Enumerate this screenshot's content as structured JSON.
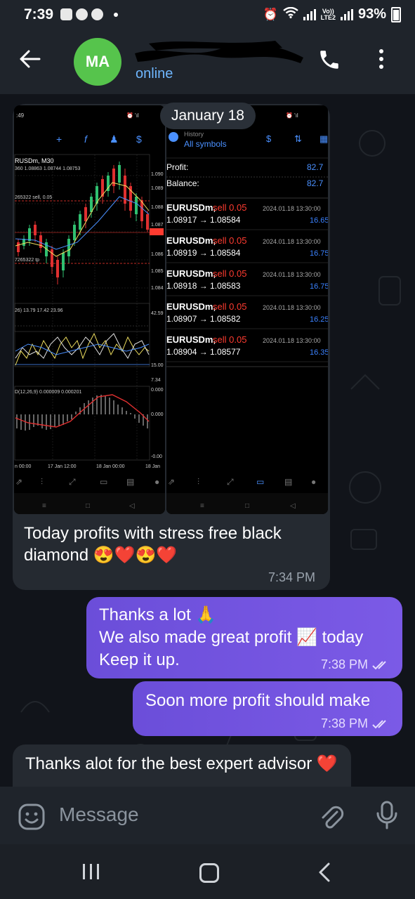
{
  "status_bar": {
    "time": "7:39",
    "battery": "93%",
    "network": "LTE2",
    "volte": "Vo))"
  },
  "header": {
    "avatar_initials": "MA",
    "status": "online",
    "back_icon": "arrow-left-icon",
    "call_icon": "phone-icon",
    "menu_icon": "more-vertical-icon"
  },
  "chat": {
    "date_pill": "January 18",
    "messages": [
      {
        "direction": "in",
        "text": "Today  profits with stress free black diamond 😍❤️😍❤️",
        "time": "7:34 PM"
      },
      {
        "direction": "out",
        "lines": [
          "Thanks a lot 🙏",
          "We also made great profit 📈 today",
          "Keep it up."
        ],
        "time": "7:38 PM"
      },
      {
        "direction": "out",
        "text": "Soon more profit should make",
        "time": "7:38 PM"
      },
      {
        "direction": "in",
        "text": "Thanks alot for the best expert advisor ❤️"
      }
    ]
  },
  "screenshot_left": {
    "symbol": "RUSDm, M30",
    "ohlc": "360 1.08863 1.08744 1.08753",
    "order_line": "265322 sell, 0.05",
    "tp_line": "7265322 tp",
    "indicator1": "26) 13.79 17.42 23.96",
    "indicator2": "D(12,26,9) 0.000009 0.000201",
    "price_labels": [
      "1.090",
      "1.089",
      "1.088",
      "1.087",
      "1.086",
      "1.085",
      "1.084"
    ],
    "ind_labels": [
      "42.59",
      "15.00",
      "7.34",
      "0.000",
      "0.000",
      "-0.00"
    ],
    "x_labels": [
      "n 00:00",
      "17 Jan 12:00",
      "18 Jan 00:00",
      "18 Jan"
    ]
  },
  "screenshot_right": {
    "title_small": "History",
    "title": "All symbols",
    "profit_label": "Profit:",
    "profit_value": "82.7",
    "balance_label": "Balance:",
    "balance_value": "82.7",
    "trades": [
      {
        "symbol": "EURUSDm,",
        "side": "sell 0.05",
        "date": "2024.01.18 13:30:00",
        "prices": "1.08917 → 1.08584",
        "profit": "16.65"
      },
      {
        "symbol": "EURUSDm,",
        "side": "sell 0.05",
        "date": "2024.01.18 13:30:00",
        "prices": "1.08919 → 1.08584",
        "profit": "16.75"
      },
      {
        "symbol": "EURUSDm,",
        "side": "sell 0.05",
        "date": "2024.01.18 13:30:00",
        "prices": "1.08918 → 1.08583",
        "profit": "16.75"
      },
      {
        "symbol": "EURUSDm,",
        "side": "sell 0.05",
        "date": "2024.01.18 13:30:00",
        "prices": "1.08907 → 1.08582",
        "profit": "16.25"
      },
      {
        "symbol": "EURUSDm,",
        "side": "sell 0.05",
        "date": "2024.01.18 13:30:00",
        "prices": "1.08904 → 1.08577",
        "profit": "16.35"
      }
    ]
  },
  "input": {
    "placeholder": "Message"
  },
  "colors": {
    "accent": "#6fb7ff",
    "bubble_out": "#7452e0",
    "bubble_in": "#252a31",
    "avatar": "#56c44c",
    "sell_red": "#ff3b30",
    "profit_blue": "#3b82ff"
  }
}
